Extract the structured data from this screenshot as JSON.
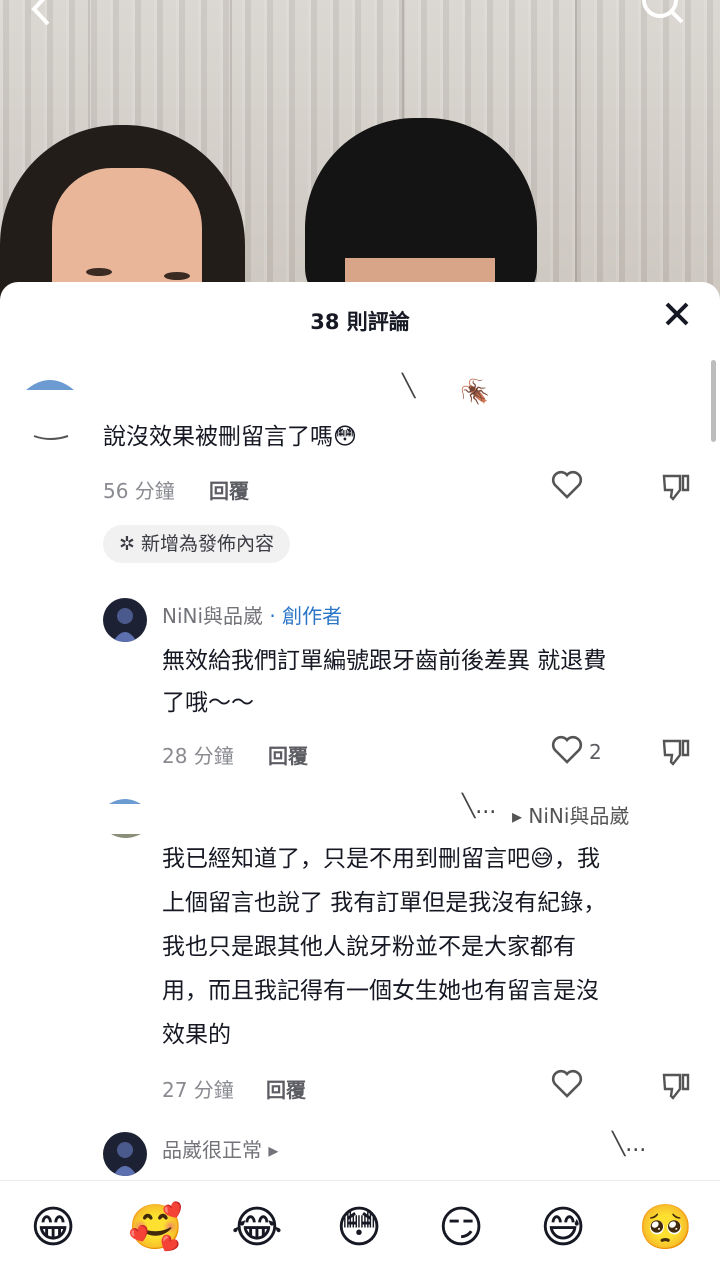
{
  "header": {
    "back_icon": "chevron-left-icon",
    "search_icon": "search-icon"
  },
  "sheet": {
    "title": "38 則評論",
    "close_icon": "close-icon"
  },
  "comments": [
    {
      "text": "說沒效果被刪留言了嗎😳",
      "time": "56 分鐘",
      "reply_label": "回覆",
      "pill_label": "✲ 新增為發佈內容"
    }
  ],
  "replies": [
    {
      "username": "NiNi與品崴",
      "creator_tag": "· 創作者",
      "text_line1": "無效給我們訂單編號跟牙齒前後差異 就退費",
      "text_line2": "了哦～～",
      "time": "28 分鐘",
      "reply_label": "回覆",
      "likes": "2"
    },
    {
      "reply_to": "▸ NiNi與品崴",
      "text_line1": "我已經知道了，只是不用到刪留言吧😅，我",
      "text_line2": "上個留言也說了 我有訂單但是我沒有紀錄，",
      "text_line3": "我也只是跟其他人說牙粉並不是大家都有",
      "text_line4": "用，而且我記得有一個女生她也有留言是沒",
      "text_line5": "效果的",
      "time": "27 分鐘",
      "reply_label": "回覆"
    },
    {
      "username": "品崴很正常 ▸"
    }
  ],
  "emoji_bar": [
    "😁",
    "🥰",
    "😂",
    "😳",
    "😏",
    "😅",
    "🥺"
  ],
  "colors": {
    "creator_accent": "#2a75c7",
    "text_primary": "#161823",
    "text_secondary": "#8a8b91"
  }
}
